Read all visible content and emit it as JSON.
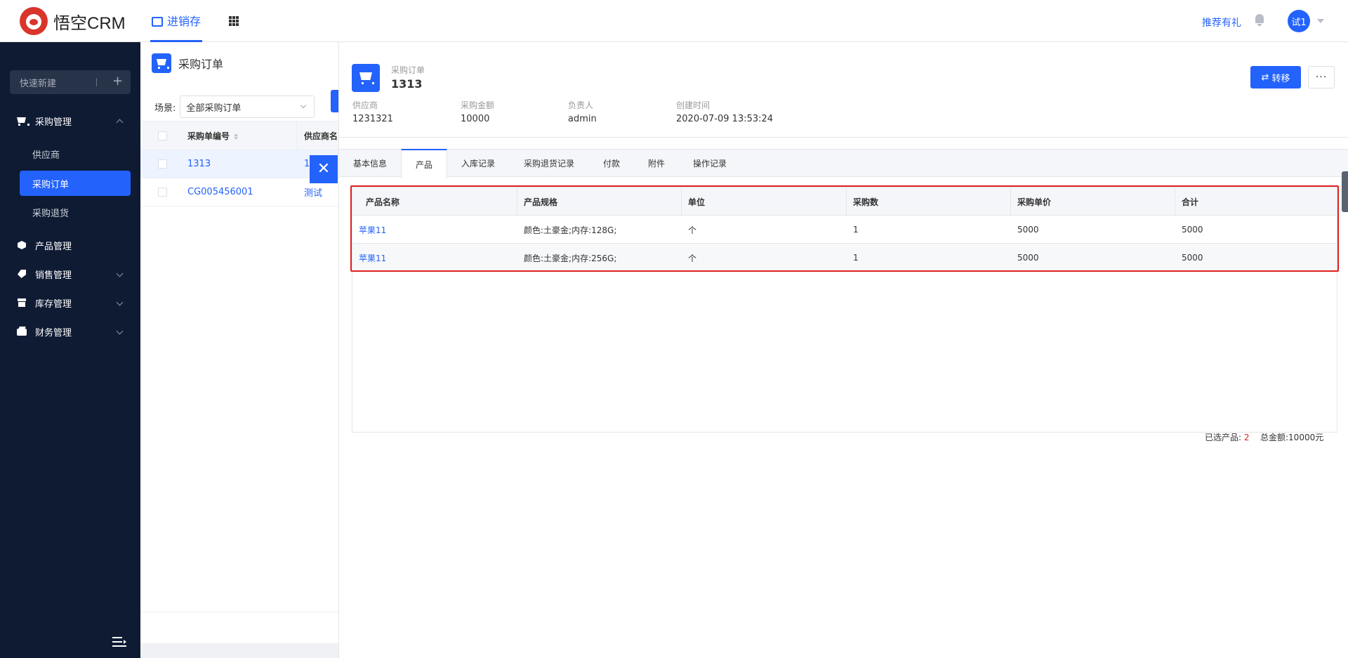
{
  "topbar": {
    "logo_text": "悟空CRM",
    "nav_tab": "进销存",
    "recommend": "推荐有礼",
    "avatar_text": "试1"
  },
  "sidebar": {
    "quick_new": "快速新建",
    "groups": [
      {
        "label": "采购管理",
        "icon": "cart-icon",
        "expanded": true
      },
      {
        "label": "产品管理",
        "icon": "box-icon"
      },
      {
        "label": "销售管理",
        "icon": "tag-icon"
      },
      {
        "label": "库存管理",
        "icon": "warehouse-icon"
      },
      {
        "label": "财务管理",
        "icon": "wallet-icon"
      }
    ],
    "sub_items": [
      {
        "label": "供应商"
      },
      {
        "label": "采购订单",
        "active": true
      },
      {
        "label": "采购退货"
      }
    ]
  },
  "list": {
    "title": "采购订单",
    "scene_label": "场景:",
    "scene_value": "全部采购订单",
    "columns": [
      "采购单编号",
      "供应商名"
    ],
    "rows": [
      {
        "code": "1313",
        "supplier": "1"
      },
      {
        "code": "CG005456001",
        "supplier": "测试"
      }
    ]
  },
  "detail": {
    "type_label": "采购订单",
    "title": "1313",
    "fields": [
      {
        "label": "供应商",
        "value": "1231321"
      },
      {
        "label": "采购金额",
        "value": "10000"
      },
      {
        "label": "负责人",
        "value": "admin"
      },
      {
        "label": "创建时间",
        "value": "2020-07-09 13:53:24"
      }
    ],
    "transfer_button": "转移",
    "more_button": "···",
    "tabs": [
      "基本信息",
      "产品",
      "入库记录",
      "采购退货记录",
      "付款",
      "附件",
      "操作记录"
    ],
    "active_tab": "产品",
    "product_table": {
      "columns": [
        "产品名称",
        "产品规格",
        "单位",
        "采购数",
        "采购单价",
        "合计"
      ],
      "rows": [
        [
          "苹果11",
          "颜色:土豪金;内存:128G;",
          "个",
          "1",
          "5000",
          "5000"
        ],
        [
          "苹果11",
          "颜色:土豪金;内存:256G;",
          "个",
          "1",
          "5000",
          "5000"
        ]
      ]
    },
    "summary": {
      "selected_label": "已选产品:",
      "selected_count": "2",
      "total_label": "总金额:",
      "total_value": "10000元"
    }
  },
  "colors": {
    "primary": "#2362fb",
    "sidebar_bg": "#0e1b33",
    "highlight": "#e02020"
  }
}
